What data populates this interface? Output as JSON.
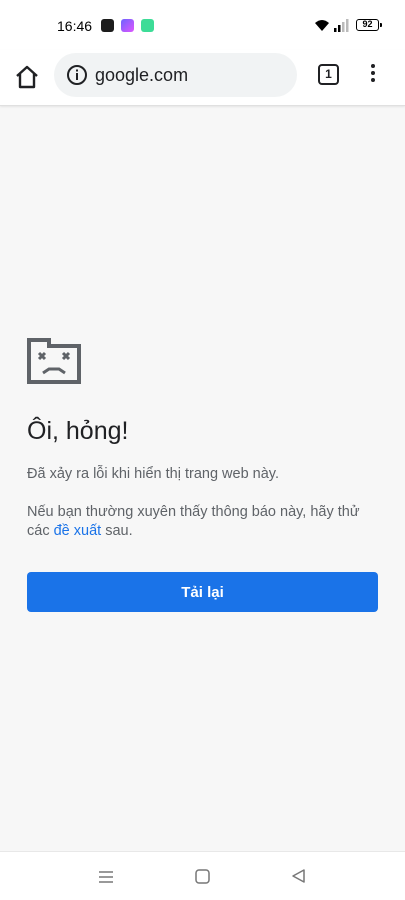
{
  "status_bar": {
    "time": "16:46",
    "battery_level": "92",
    "app_icons": [
      "shopping-bag-icon",
      "app-icon-purple",
      "app-icon-green"
    ]
  },
  "toolbar": {
    "url": "google.com",
    "tab_count": "1"
  },
  "error_page": {
    "title": "Ôi, hỏng!",
    "message": "Đã xảy ra lỗi khi hiển thị trang web này.",
    "hint_prefix": "Nếu bạn thường xuyên thấy thông báo này, hãy thử các ",
    "hint_link": "đề xuất",
    "hint_suffix": " sau.",
    "reload_label": "Tải lại"
  },
  "colors": {
    "accent": "#1a73e8",
    "background": "#f7f7f7"
  }
}
